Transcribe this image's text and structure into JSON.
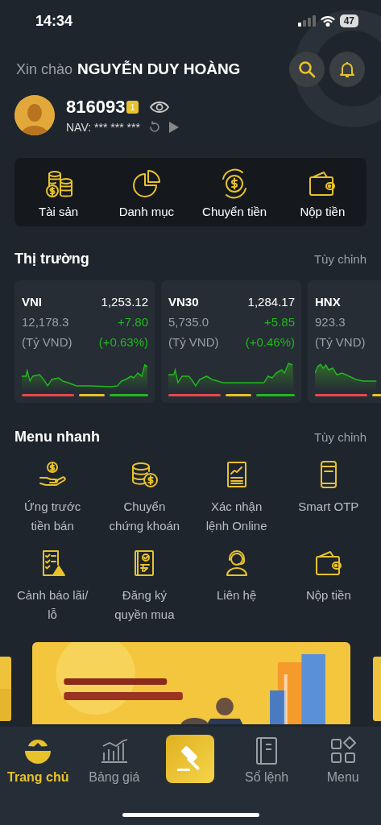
{
  "status_bar": {
    "time": "14:34",
    "battery": "47"
  },
  "header": {
    "greeting": "Xin chào",
    "name": "NGUYỄN DUY HOÀNG",
    "account": "816093",
    "account_badge": "1",
    "nav_label": "NAV:",
    "nav_value": "*** *** ***"
  },
  "quick_actions": [
    {
      "label": "Tài sản"
    },
    {
      "label": "Danh mục"
    },
    {
      "label": "Chuyển tiền"
    },
    {
      "label": "Nộp tiền"
    }
  ],
  "market": {
    "title": "Thị trường",
    "action": "Tùy chỉnh",
    "indices": [
      {
        "name": "VNI",
        "value": "1,253.12",
        "volume": "12,178.3",
        "unit": "(Tỷ VND)",
        "change": "+7.80",
        "change_pct": "(+0.63%)"
      },
      {
        "name": "VN30",
        "value": "1,284.17",
        "volume": "5,735.0",
        "unit": "(Tỷ VND)",
        "change": "+5.85",
        "change_pct": "(+0.46%)"
      },
      {
        "name": "HNX",
        "volume": "923.3",
        "unit": "(Tỷ VND)"
      }
    ]
  },
  "quick_menu": {
    "title": "Menu nhanh",
    "action": "Tùy chỉnh",
    "items": [
      {
        "label": "Ứng trước tiền bán"
      },
      {
        "label": "Chuyển chứng khoán"
      },
      {
        "label": "Xác nhận lệnh Online"
      },
      {
        "label": "Smart OTP"
      },
      {
        "label": "Cảnh báo lãi/ lỗ"
      },
      {
        "label": "Đăng ký quyền mua"
      },
      {
        "label": "Liên hệ"
      },
      {
        "label": "Nộp tiền"
      }
    ]
  },
  "bottom_nav": [
    {
      "kind": "tab",
      "label": "Trang chủ",
      "selected": true
    },
    {
      "kind": "tab",
      "label": "Bảng giá",
      "selected": false
    },
    {
      "kind": "action"
    },
    {
      "kind": "tab",
      "label": "Sổ lệnh",
      "selected": false
    },
    {
      "kind": "tab",
      "label": "Menu",
      "selected": false
    }
  ]
}
